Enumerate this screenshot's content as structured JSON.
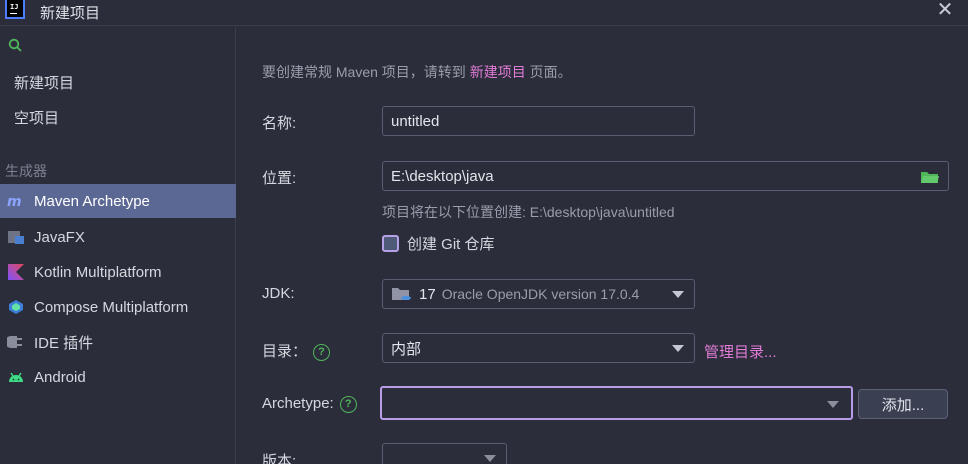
{
  "window": {
    "title": "新建项目",
    "close_glyph": "✕"
  },
  "sidebar": {
    "search_placeholder": "",
    "top_items": [
      {
        "label": "新建项目"
      },
      {
        "label": "空项目"
      }
    ],
    "section_label": "生成器",
    "generators": [
      {
        "label": "Maven Archetype",
        "icon": "maven-icon",
        "selected": true
      },
      {
        "label": "JavaFX",
        "icon": "javafx-icon",
        "selected": false
      },
      {
        "label": "Kotlin Multiplatform",
        "icon": "kotlin-icon",
        "selected": false
      },
      {
        "label": "Compose Multiplatform",
        "icon": "compose-icon",
        "selected": false
      },
      {
        "label": "IDE 插件",
        "icon": "plugin-icon",
        "selected": false
      },
      {
        "label": "Android",
        "icon": "android-icon",
        "selected": false
      }
    ]
  },
  "main": {
    "hint_prefix": "要创建常规 Maven 项目，请转到",
    "hint_link": "新建项目",
    "hint_suffix": "页面。",
    "name_label": "名称:",
    "name_value": "untitled",
    "location_label": "位置:",
    "location_value": "E:\\desktop\\java",
    "location_hint": "项目将在以下位置创建: E:\\desktop\\java\\untitled",
    "git_label": "创建 Git 仓库",
    "jdk_label": "JDK:",
    "jdk_version": "17",
    "jdk_desc": "Oracle OpenJDK version 17.0.4",
    "catalog_label": "目录：",
    "catalog_value": "内部",
    "manage_link": "管理目录...",
    "archetype_label": "Archetype:",
    "archetype_value": "",
    "add_button": "添加...",
    "version_label": "版本:",
    "version_value": ""
  },
  "colors": {
    "background": "#2b2d3a",
    "selected": "#5b6893",
    "link": "#e07bd6",
    "focus": "#b89ce8",
    "help": "#4fb65a"
  }
}
